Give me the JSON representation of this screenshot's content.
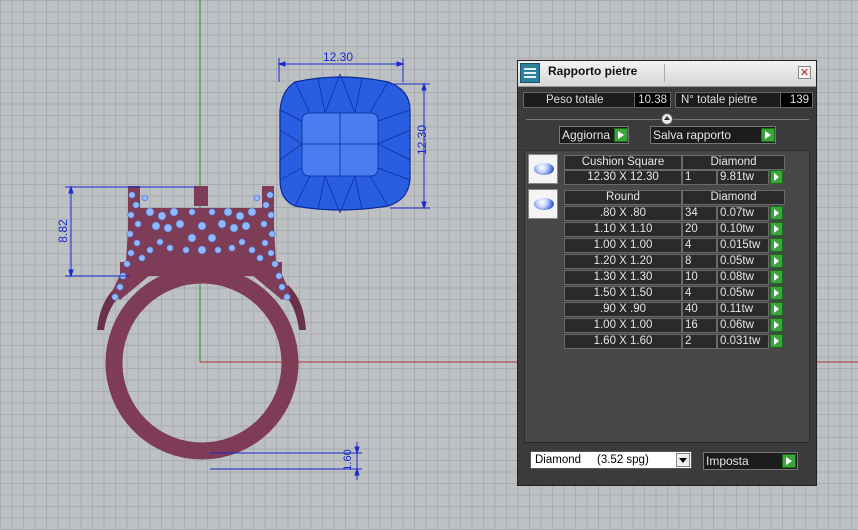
{
  "viewport": {
    "dimensions": {
      "stone_width": "12.30",
      "stone_height": "12.30",
      "setting_height": "8.82",
      "shank_thickness": "1.60"
    }
  },
  "panel": {
    "title": "Rapporto pietre",
    "total_weight_label": "Peso totale",
    "total_weight_value": "10.38",
    "total_stones_label": "N° totale pietre",
    "total_stones_value": "139",
    "update_button": "Aggiorna",
    "save_button": "Salva rapporto",
    "groups": [
      {
        "shape": "Cushion Square",
        "material": "Diamond",
        "rows": [
          {
            "size": "12.30 X 12.30",
            "count": "1",
            "weight": "9.81tw"
          }
        ]
      },
      {
        "shape": "Round",
        "material": "Diamond",
        "rows": [
          {
            "size": ".80 X .80",
            "count": "34",
            "weight": "0.07tw"
          },
          {
            "size": "1.10 X 1.10",
            "count": "20",
            "weight": "0.10tw"
          },
          {
            "size": "1.00 X 1.00",
            "count": "4",
            "weight": "0.015tw"
          },
          {
            "size": "1.20 X 1.20",
            "count": "8",
            "weight": "0.05tw"
          },
          {
            "size": "1.30 X 1.30",
            "count": "10",
            "weight": "0.08tw"
          },
          {
            "size": "1.50 X 1.50",
            "count": "4",
            "weight": "0.05tw"
          },
          {
            "size": ".90 X .90",
            "count": "40",
            "weight": "0.11tw"
          },
          {
            "size": "1.00 X 1.00",
            "count": "16",
            "weight": "0.06tw"
          },
          {
            "size": "1.60 X 1.60",
            "count": "2",
            "weight": "0.031tw"
          }
        ]
      }
    ],
    "material_select": "Diamond     (3.52 spg)",
    "apply_button": "Imposta"
  },
  "colors": {
    "viewport_bg": "#bec1c4",
    "ring_metal": "#7e3c57",
    "gem_blue": "#2a5ee0",
    "melee_blue": "#8fb8ff",
    "dimension_blue": "#1a2acc",
    "panel_bg": "#3b3b3b",
    "arrow_green": "#3aa53a"
  }
}
